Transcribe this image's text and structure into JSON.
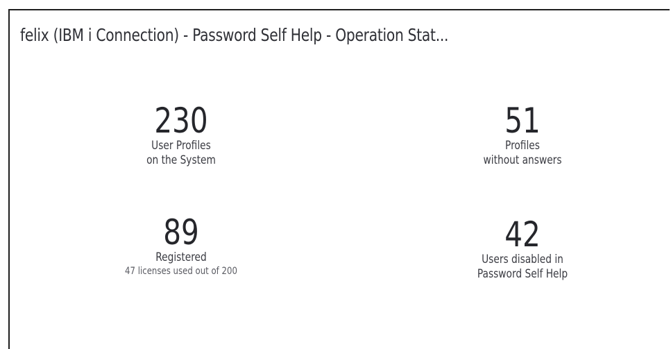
{
  "panel": {
    "title": "felix (IBM i Connection) - Password Self Help - Operation Stat..."
  },
  "stats": {
    "user_profiles": {
      "value": "230",
      "label_line1": "User Profiles",
      "label_line2": "on the System"
    },
    "profiles_without_answers": {
      "value": "51",
      "label_line1": "Profiles",
      "label_line2": "without answers"
    },
    "registered": {
      "value": "89",
      "label": "Registered",
      "sublabel": "47 licenses used out of 200"
    },
    "users_disabled": {
      "value": "42",
      "label_line1": "Users disabled in",
      "label_line2": "Password Self Help"
    }
  }
}
